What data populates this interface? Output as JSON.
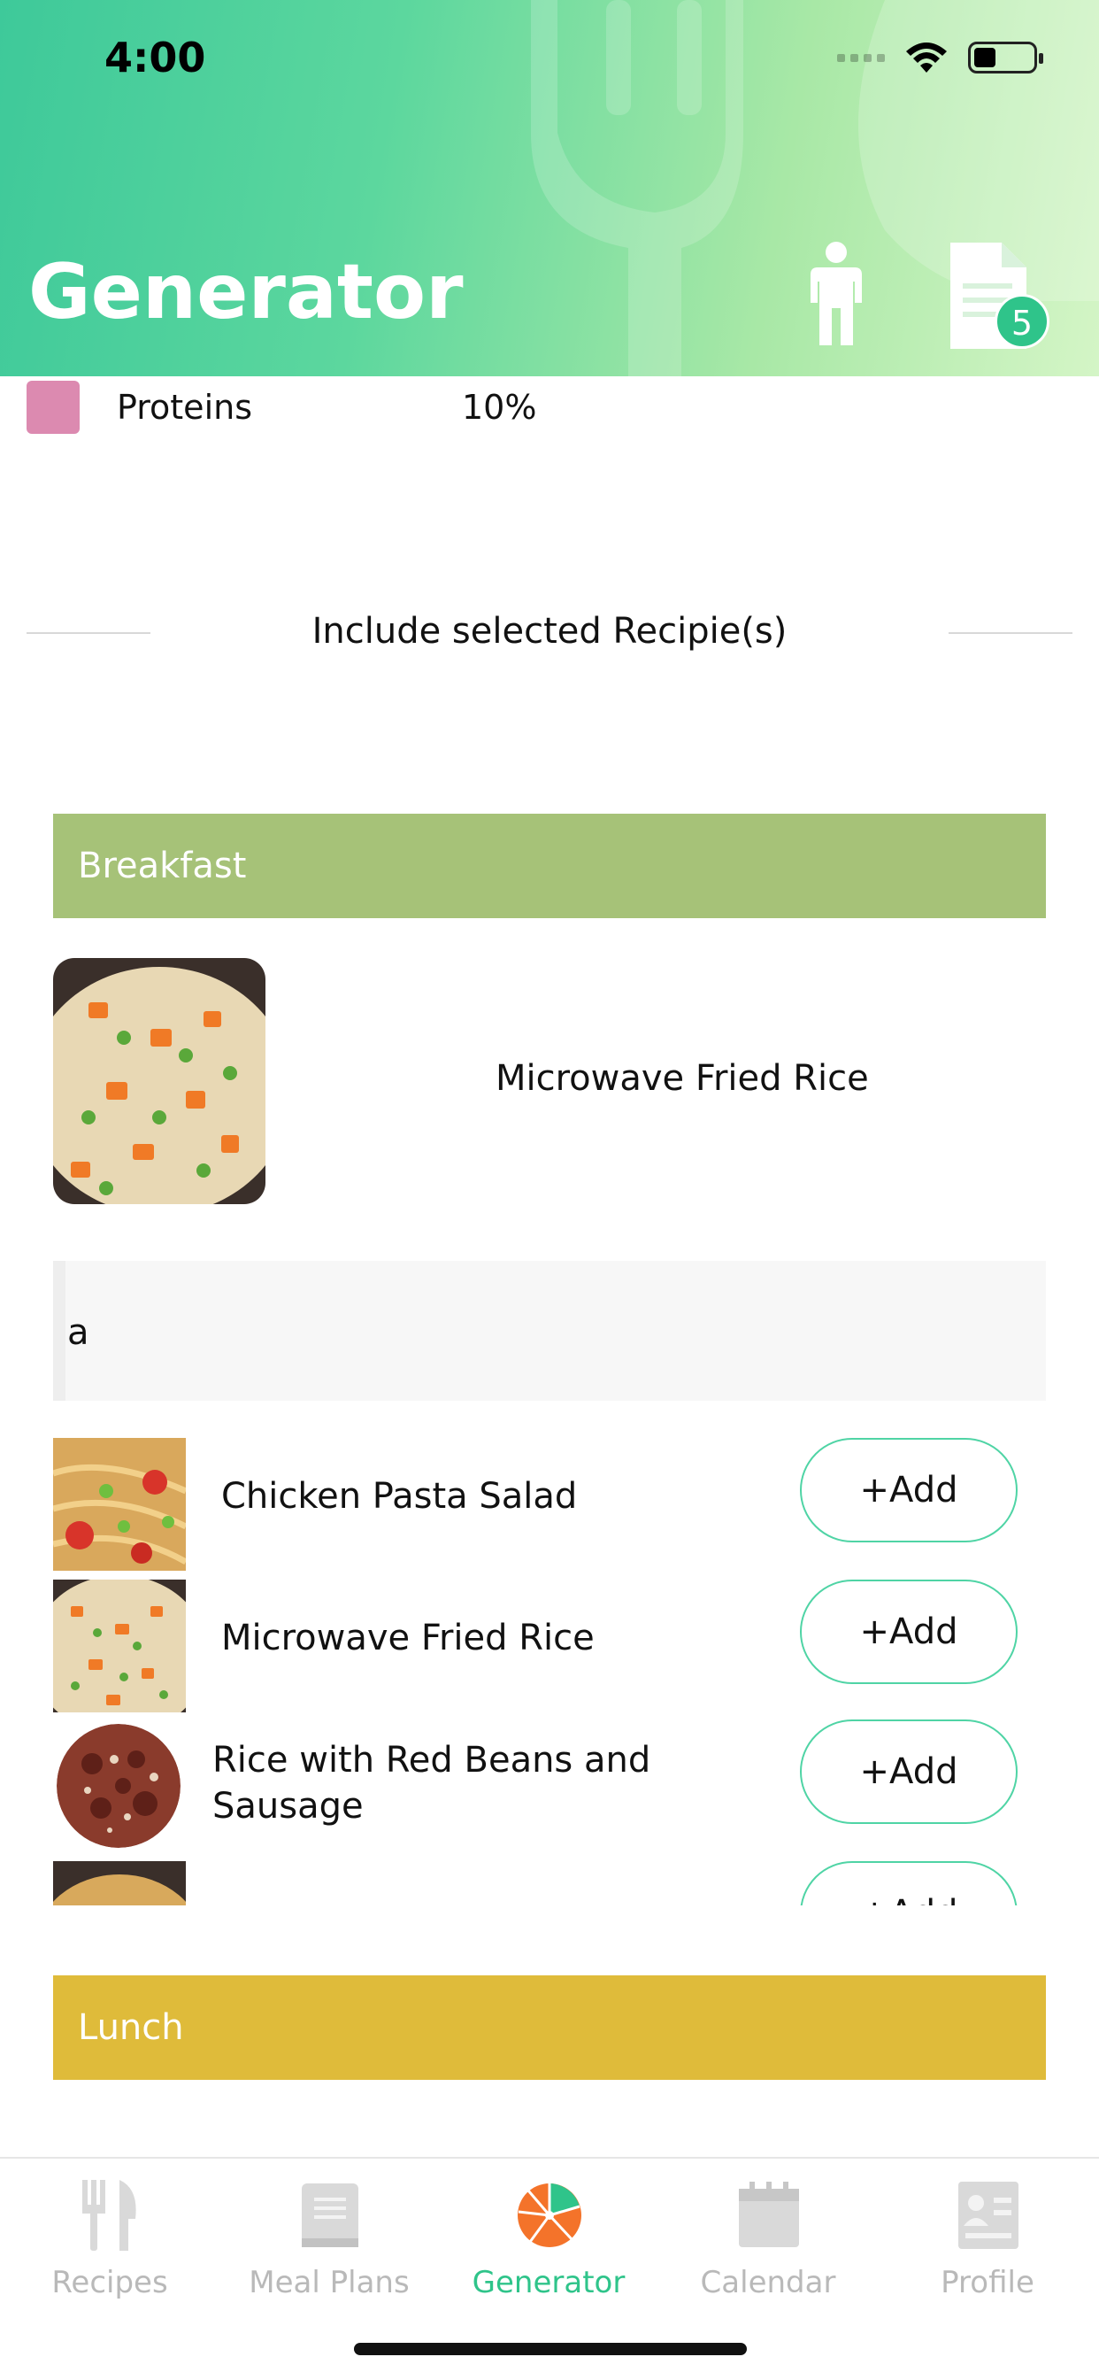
{
  "status_bar": {
    "time": "4:00"
  },
  "header": {
    "title": "Generator",
    "badge_count": "5"
  },
  "legend": {
    "label": "Proteins",
    "value": "10%",
    "color": "#dc8ab0"
  },
  "include_section": {
    "title": "Include selected Recipie(s)"
  },
  "breakfast": {
    "header": "Breakfast",
    "color": "#a6c278",
    "selected_recipe": "Microwave Fried Rice",
    "search_value": "a"
  },
  "results": [
    {
      "name": "Chicken Pasta Salad",
      "button": "+Add"
    },
    {
      "name": "Microwave Fried Rice",
      "button": "+Add"
    },
    {
      "name": "Rice with Red Beans and Sausage",
      "button": "+Add"
    },
    {
      "name": "",
      "button": "+Add"
    }
  ],
  "lunch": {
    "header": "Lunch",
    "color": "#dfbb3a"
  },
  "tabs": [
    {
      "label": "Recipes",
      "icon": "fork-knife-icon"
    },
    {
      "label": "Meal Plans",
      "icon": "book-icon"
    },
    {
      "label": "Generator",
      "icon": "orange-slice-icon",
      "active": true
    },
    {
      "label": "Calendar",
      "icon": "calendar-icon"
    },
    {
      "label": "Profile",
      "icon": "id-card-icon"
    }
  ],
  "accent_color": "#2fc48a"
}
